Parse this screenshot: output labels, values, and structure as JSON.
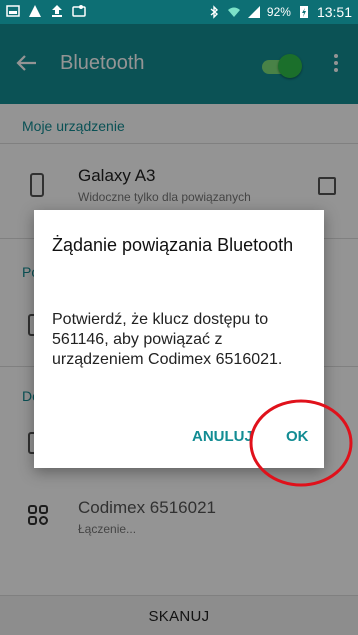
{
  "status_bar": {
    "battery": "92%",
    "time": "13:51"
  },
  "app_bar": {
    "title": "Bluetooth",
    "toggle_state": "on"
  },
  "content": {
    "my_device_header": "Moje urządzenie",
    "my_device": {
      "name": "Galaxy A3",
      "subtitle": "Widoczne tylko dla powiązanych urządzeń"
    },
    "paired_header_partial": "Po",
    "available_header_partial": "Do",
    "codimex": {
      "name": "Codimex 6516021",
      "status": "Łączenie..."
    }
  },
  "dialog": {
    "title": "Żądanie powiązania Bluetooth",
    "body": "Potwierdź, że klucz dostępu to 561146, aby powiązać z urządzeniem Codimex 6516021.",
    "cancel_label": "ANULUJ",
    "ok_label": "OK"
  },
  "bottom_bar": {
    "scan_label": "SKANUJ"
  },
  "colors": {
    "status_bar": "#0d6f74",
    "app_bar": "#138d93",
    "accent": "#128c93",
    "toggle_on": "#2fbf4a",
    "annotation": "#e0111b"
  }
}
